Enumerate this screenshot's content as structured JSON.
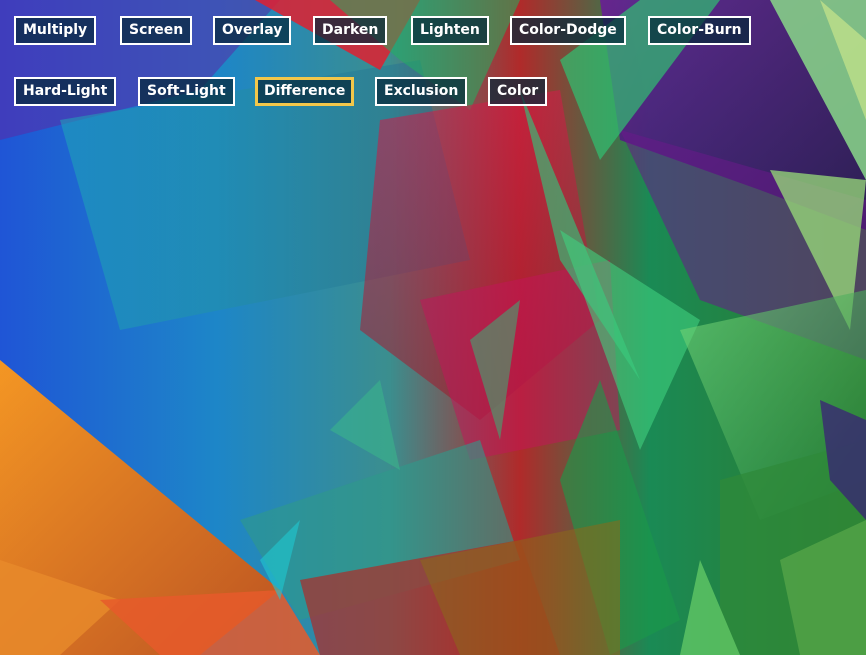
{
  "blend_modes": {
    "row1": [
      "Multiply",
      "Screen",
      "Overlay",
      "Darken",
      "Lighten",
      "Color-Dodge",
      "Color-Burn"
    ],
    "row2": [
      "Hard-Light",
      "Soft-Light",
      "Difference",
      "Exclusion",
      "Color"
    ],
    "selected": "Difference"
  },
  "colors": {
    "button_background": "#06283a",
    "button_border": "#ffffff",
    "selected_border": "#f3c74a"
  },
  "canvas": {
    "description_icon": "blended-pattern-canvas"
  }
}
